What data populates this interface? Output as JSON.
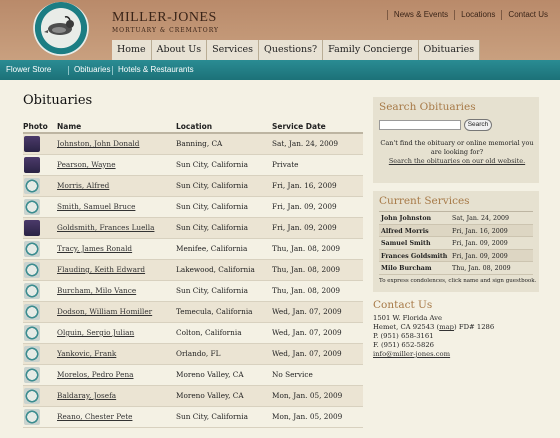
{
  "brand": {
    "name": "Miller-Jones",
    "tagline": "Mortuary & Crematory"
  },
  "topnav": [
    "News & Events",
    "Locations",
    "Contact Us"
  ],
  "mainnav": [
    "Home",
    "About Us",
    "Services",
    "Questions?",
    "Family Concierge",
    "Obituaries"
  ],
  "subnav": [
    "Flower Store",
    "Obituaries",
    "Hotels & Restaurants"
  ],
  "page": {
    "title": "Obituaries"
  },
  "table": {
    "headers": {
      "photo": "Photo",
      "name": "Name",
      "location": "Location",
      "date": "Service Date"
    },
    "rows": [
      {
        "photo": "person",
        "name": "Johnston, John Donald",
        "location": "Banning, CA",
        "date": "Sat, Jan. 24, 2009"
      },
      {
        "photo": "person",
        "name": "Pearson, Wayne",
        "location": "Sun City, California",
        "date": "Private"
      },
      {
        "photo": "default",
        "name": "Morris, Alfred",
        "location": "Sun City, California",
        "date": "Fri, Jan. 16, 2009"
      },
      {
        "photo": "default",
        "name": "Smith, Samuel Bruce",
        "location": "Sun City, California",
        "date": "Fri, Jan. 09, 2009"
      },
      {
        "photo": "person",
        "name": "Goldsmith, Frances Luella",
        "location": "Sun City, California",
        "date": "Fri, Jan. 09, 2009"
      },
      {
        "photo": "default",
        "name": "Tracy, James Ronald",
        "location": "Menifee, California",
        "date": "Thu, Jan. 08, 2009"
      },
      {
        "photo": "default",
        "name": "Flauding, Keith Edward",
        "location": "Lakewood, California",
        "date": "Thu, Jan. 08, 2009"
      },
      {
        "photo": "default",
        "name": "Burcham, Milo Vance",
        "location": "Sun City, California",
        "date": "Thu, Jan. 08, 2009"
      },
      {
        "photo": "default",
        "name": "Dodson, William Homiller",
        "location": "Temecula, California",
        "date": "Wed, Jan. 07, 2009"
      },
      {
        "photo": "default",
        "name": "Olguin, Sergio Julian",
        "location": "Colton, California",
        "date": "Wed, Jan. 07, 2009"
      },
      {
        "photo": "default",
        "name": "Yankovic, Frank",
        "location": "Orlando, FL",
        "date": "Wed, Jan. 07, 2009"
      },
      {
        "photo": "default",
        "name": "Morelos, Pedro Pena",
        "location": "Moreno Valley, CA",
        "date": "No Service"
      },
      {
        "photo": "default",
        "name": "Baldaray, Josefa",
        "location": "Moreno Valley, CA",
        "date": "Mon, Jan. 05, 2009"
      },
      {
        "photo": "default",
        "name": "Reano, Chester Pete",
        "location": "Sun City, California",
        "date": "Mon, Jan. 05, 2009"
      }
    ]
  },
  "search": {
    "title": "Search Obituaries",
    "button": "Search",
    "help": "Can't find the obituary or online memorial you are looking for?",
    "link": "Search the obituaries on our old website."
  },
  "current": {
    "title": "Current Services",
    "rows": [
      {
        "name": "John Johnston",
        "date": "Sat, Jan. 24, 2009"
      },
      {
        "name": "Alfred Morris",
        "date": "Fri, Jan. 16, 2009"
      },
      {
        "name": "Samuel Smith",
        "date": "Fri, Jan. 09, 2009"
      },
      {
        "name": "Frances Goldsmith",
        "date": "Fri, Jan. 09, 2009"
      },
      {
        "name": "Milo Burcham",
        "date": "Thu, Jan. 08, 2009"
      }
    ],
    "note": "To express condolences, click name and sign guestbook."
  },
  "contact": {
    "title": "Contact Us",
    "address1": "1501 W. Florida Ave",
    "address2_pre": "Hemet, CA 92543 (",
    "map": "map",
    "address2_post": ") FD# 1286",
    "phone": "P. (951) 658-3161",
    "fax": "F. (951) 652-5826",
    "email": "info@miller-jones.com"
  }
}
